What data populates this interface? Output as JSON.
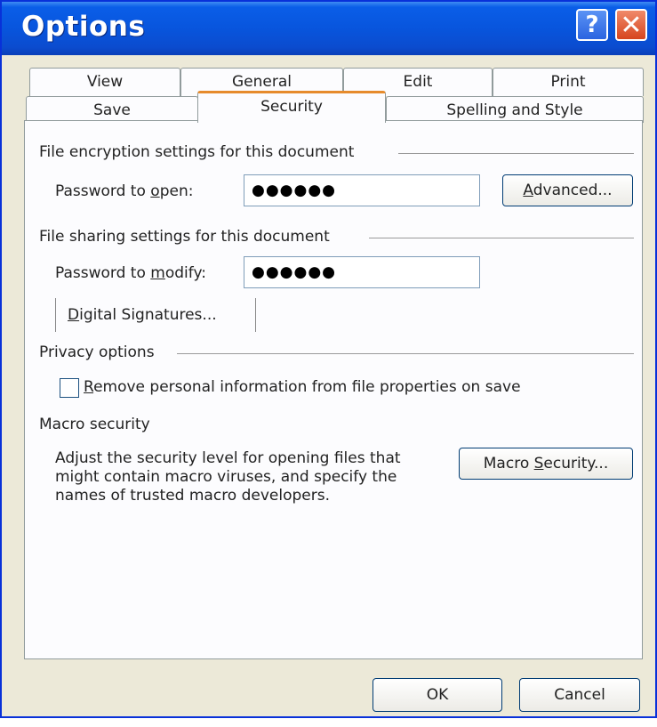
{
  "window": {
    "title": "Options"
  },
  "titlebar_buttons": {
    "help": "?",
    "close": "✕"
  },
  "tabs_row1": [
    "View",
    "General",
    "Edit",
    "Print"
  ],
  "tabs_row2": [
    "Save",
    "Security",
    "Spelling and Style"
  ],
  "active_tab": "Security",
  "encryption": {
    "heading": "File encryption settings for this document",
    "password_label_pre": "Password to ",
    "password_label_u": "o",
    "password_label_post": "pen:",
    "password_value": "●●●●●●",
    "advanced_u": "A",
    "advanced_rest": "dvanced..."
  },
  "sharing": {
    "heading": "File sharing settings for this document",
    "password_label_pre": "Password to ",
    "password_label_u": "m",
    "password_label_post": "odify:",
    "password_value": "●●●●●●",
    "signatures_u": "D",
    "signatures_rest": "igital Signatures..."
  },
  "privacy": {
    "heading": "Privacy options",
    "checkbox_u": "R",
    "checkbox_rest": "emove personal information from file properties on save",
    "checked": false
  },
  "macro": {
    "heading": "Macro security",
    "description": "Adjust the security level for opening files that might contain macro viruses, and specify the names of trusted macro developers.",
    "button_pre": "Macro ",
    "button_u": "S",
    "button_post": "ecurity..."
  },
  "footer": {
    "ok": "OK",
    "cancel": "Cancel"
  }
}
